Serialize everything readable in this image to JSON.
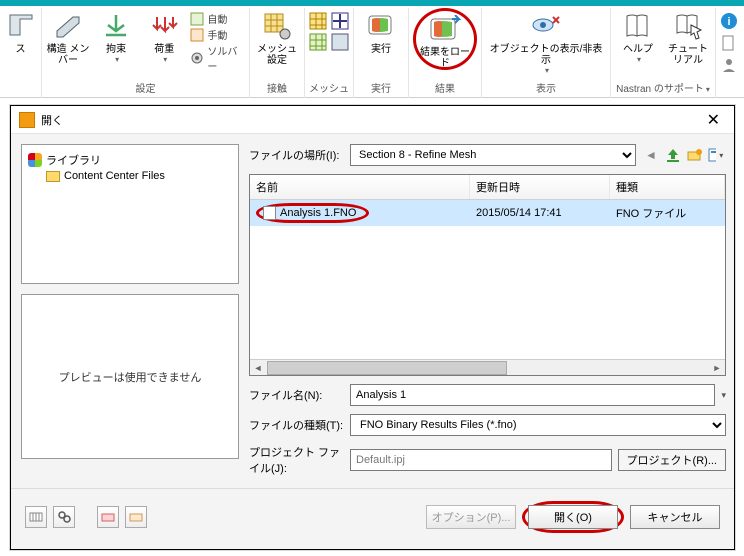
{
  "ribbon": {
    "groups": {
      "settings": {
        "label": "設定",
        "btn_struct": "構造\nメンバー",
        "btn_constraint": "拘束",
        "btn_load": "荷重",
        "auto": "自動",
        "manual": "手動",
        "solver": "ソルバー"
      },
      "contact": {
        "label": "接触",
        "btn_mesh_set": "メッシュ設定"
      },
      "mesh": {
        "label": "メッシュ"
      },
      "run": {
        "label": "実行",
        "btn_run": "実行"
      },
      "result": {
        "label": "結果",
        "btn_load_result": "結果をロード"
      },
      "display": {
        "label": "表示",
        "btn_visibility": "オブジェクトの表示/非表示"
      },
      "support": {
        "label": "Nastran のサポート",
        "btn_help": "ヘルプ",
        "btn_tutorial": "チュートリアル"
      }
    }
  },
  "dialog": {
    "title": "開く",
    "tree": {
      "root": "ライブラリ",
      "child": "Content Center Files"
    },
    "preview_text": "プレビューは使用できません",
    "loc_label": "ファイルの場所(I):",
    "loc_value": "Section 8 - Refine Mesh",
    "columns": {
      "name": "名前",
      "date": "更新日時",
      "type": "種類"
    },
    "file": {
      "name": "Analysis 1.FNO",
      "date": "2015/05/14 17:41",
      "type": "FNO ファイル"
    },
    "filename_label": "ファイル名(N):",
    "filename_value": "Analysis 1",
    "filetype_label": "ファイルの種類(T):",
    "filetype_value": "FNO Binary Results Files (*.fno)",
    "project_label": "プロジェクト ファイル(J):",
    "project_value": "Default.ipj",
    "project_btn": "プロジェクト(R)...",
    "footer": {
      "options": "オプション(P)...",
      "open": "開く(O)",
      "cancel": "キャンセル"
    }
  }
}
